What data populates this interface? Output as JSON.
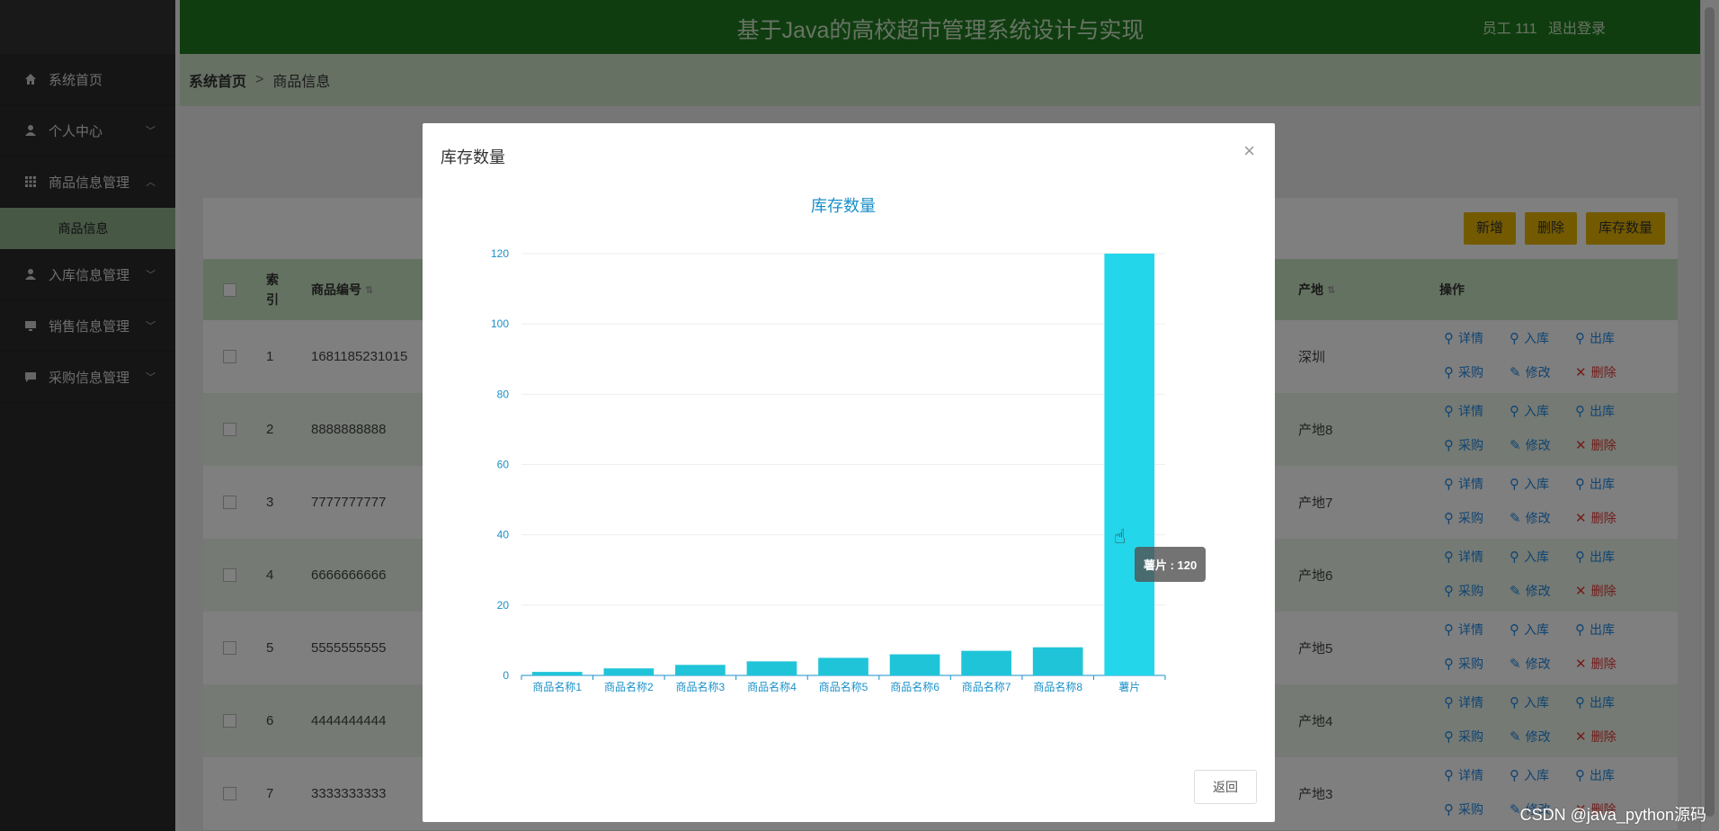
{
  "app": {
    "title": "基于Java的高校超市管理系统设计与实现",
    "user_label": "员工 111",
    "logout_label": "退出登录"
  },
  "sidebar": {
    "items": [
      {
        "label": "系统首页",
        "icon": "home-icon"
      },
      {
        "label": "个人中心",
        "icon": "user-icon"
      },
      {
        "label": "商品信息管理",
        "icon": "grid-icon"
      },
      {
        "label": "入库信息管理",
        "icon": "user-icon"
      },
      {
        "label": "销售信息管理",
        "icon": "monitor-icon"
      },
      {
        "label": "采购信息管理",
        "icon": "chat-icon"
      }
    ],
    "sub_item": "商品信息"
  },
  "breadcrumb": {
    "home": "系统首页",
    "sep": ">",
    "current": "商品信息"
  },
  "toolbar": {
    "add": "新增",
    "delete": "删除",
    "stock": "库存数量"
  },
  "table": {
    "headers": {
      "index": "索引",
      "code": "商品编号",
      "origin": "产地",
      "actions": "操作"
    },
    "rows": [
      {
        "index": "1",
        "code": "1681185231015",
        "origin": "深圳"
      },
      {
        "index": "2",
        "code": "8888888888",
        "origin": "产地8"
      },
      {
        "index": "3",
        "code": "7777777777",
        "origin": "产地7"
      },
      {
        "index": "4",
        "code": "6666666666",
        "origin": "产地6"
      },
      {
        "index": "5",
        "code": "5555555555",
        "origin": "产地5"
      },
      {
        "index": "6",
        "code": "4444444444",
        "origin": "产地4"
      },
      {
        "index": "7",
        "code": "3333333333",
        "origin": "产地3"
      }
    ],
    "ops": {
      "detail": "详情",
      "in": "入库",
      "out": "出库",
      "purchase": "采购",
      "edit": "修改",
      "remove": "删除"
    }
  },
  "modal": {
    "title": "库存数量",
    "back_label": "返回",
    "close_icon": "close-icon",
    "tooltip": "薯片 : 120"
  },
  "chart_data": {
    "type": "bar",
    "title": "库存数量",
    "categories": [
      "商品名称1",
      "商品名称2",
      "商品名称3",
      "商品名称4",
      "商品名称5",
      "商品名称6",
      "商品名称7",
      "商品名称8",
      "薯片"
    ],
    "values": [
      1,
      2,
      3,
      4,
      5,
      6,
      7,
      8,
      120
    ],
    "ylim": [
      0,
      120
    ],
    "yticks": [
      0,
      20,
      40,
      60,
      80,
      100,
      120
    ],
    "grid": true,
    "colors": {
      "bar": "#20c4d8",
      "highlight": "#24d6ea",
      "axis": "#1a90c9",
      "title": "#1a90c9"
    }
  },
  "watermark": "CSDN @java_python源码"
}
